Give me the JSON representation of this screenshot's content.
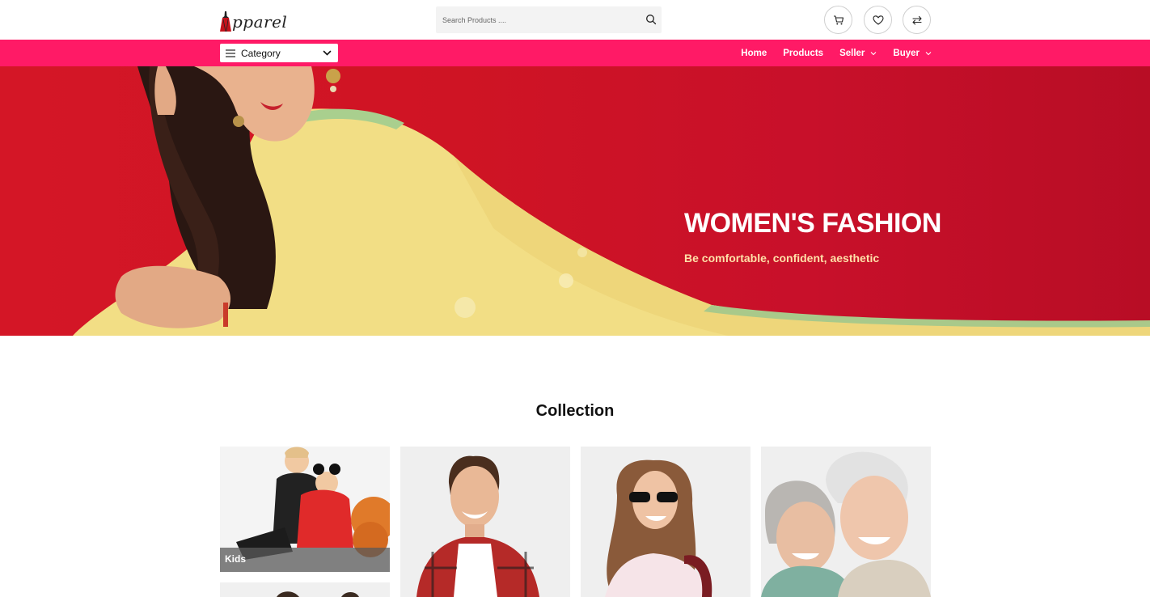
{
  "header": {
    "logo_text": "pparel",
    "search": {
      "placeholder": "Search Products ....",
      "value": ""
    },
    "icons": [
      "cart-icon",
      "heart-icon",
      "compare-icon"
    ]
  },
  "navbar": {
    "category_label": "Category",
    "links": [
      {
        "label": "Home",
        "dropdown": false
      },
      {
        "label": "Products",
        "dropdown": false
      },
      {
        "label": "Seller",
        "dropdown": true
      },
      {
        "label": "Buyer",
        "dropdown": true
      }
    ]
  },
  "hero": {
    "title": "WOMEN'S FASHION",
    "subtitle": "Be comfortable, confident, aesthetic"
  },
  "collection": {
    "title": "Collection",
    "cards": [
      {
        "label": "Kids"
      },
      {
        "label": ""
      },
      {
        "label": ""
      },
      {
        "label": ""
      }
    ]
  },
  "colors": {
    "brand_pink": "#ff1a66",
    "hero_red": "#d41626",
    "hero_subtitle": "#ffe0a8"
  }
}
